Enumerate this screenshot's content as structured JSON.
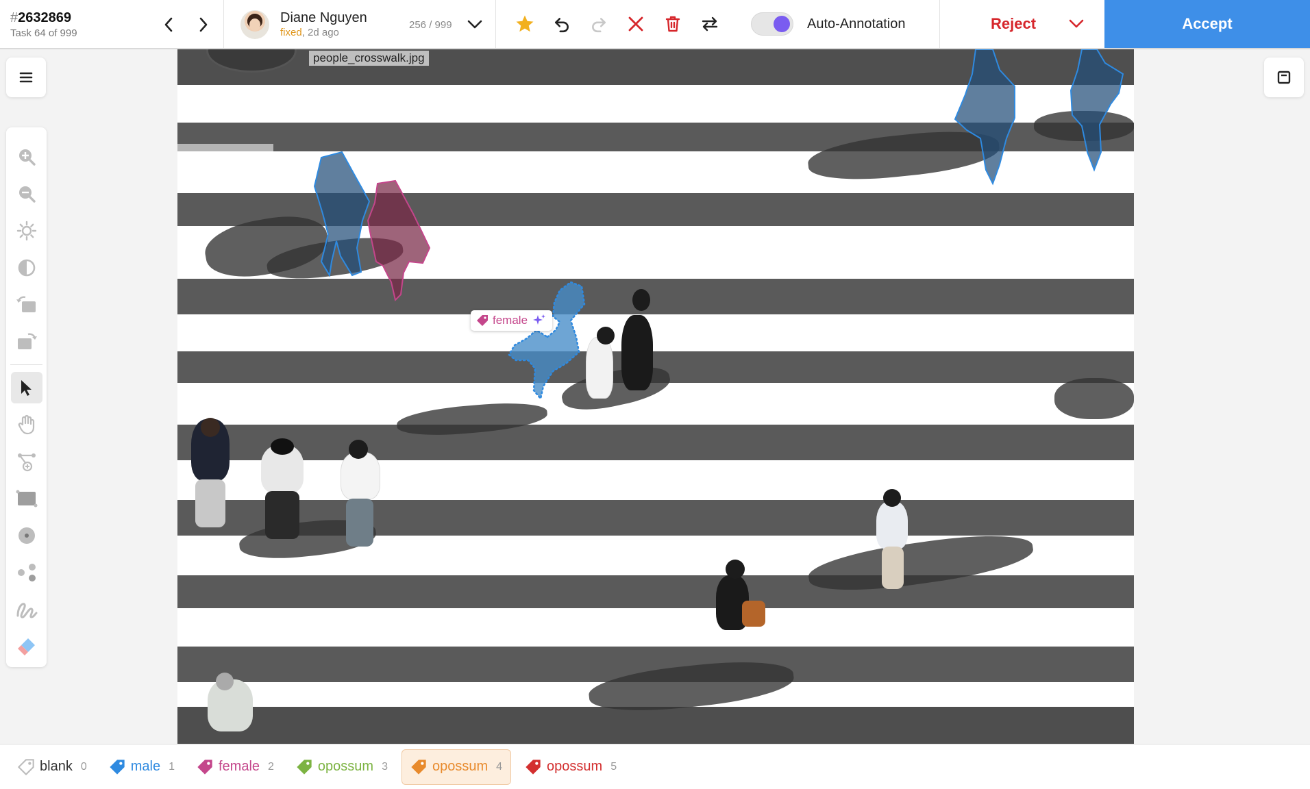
{
  "task": {
    "hash": "#",
    "id": "2632869",
    "count_text": "Task 64 of 999"
  },
  "user": {
    "name": "Diane Nguyen",
    "status_fixed": "fixed",
    "status_time": ", 2d ago",
    "counter": "256 / 999"
  },
  "auto_annotation": {
    "label": "Auto-Annotation",
    "enabled": true
  },
  "actions": {
    "reject_label": "Reject",
    "accept_label": "Accept"
  },
  "canvas": {
    "filename": "people_crosswalk.jpg",
    "selected_annotation": {
      "label": "female",
      "color": "#c4468b"
    }
  },
  "labels": [
    {
      "name": "blank",
      "hotkey": "0",
      "color": "#bdbdbd"
    },
    {
      "name": "male",
      "hotkey": "1",
      "color": "#2f8ae0"
    },
    {
      "name": "female",
      "hotkey": "2",
      "color": "#c4468b"
    },
    {
      "name": "opossum",
      "hotkey": "3",
      "color": "#7cb342"
    },
    {
      "name": "opossum",
      "hotkey": "4",
      "color": "#e88a2c"
    },
    {
      "name": "opossum",
      "hotkey": "5",
      "color": "#d32f2f"
    }
  ],
  "colors": {
    "accept": "#3e8fe8",
    "reject": "#d6262b",
    "star": "#f2b01e",
    "toggle": "#7a5cf0"
  }
}
